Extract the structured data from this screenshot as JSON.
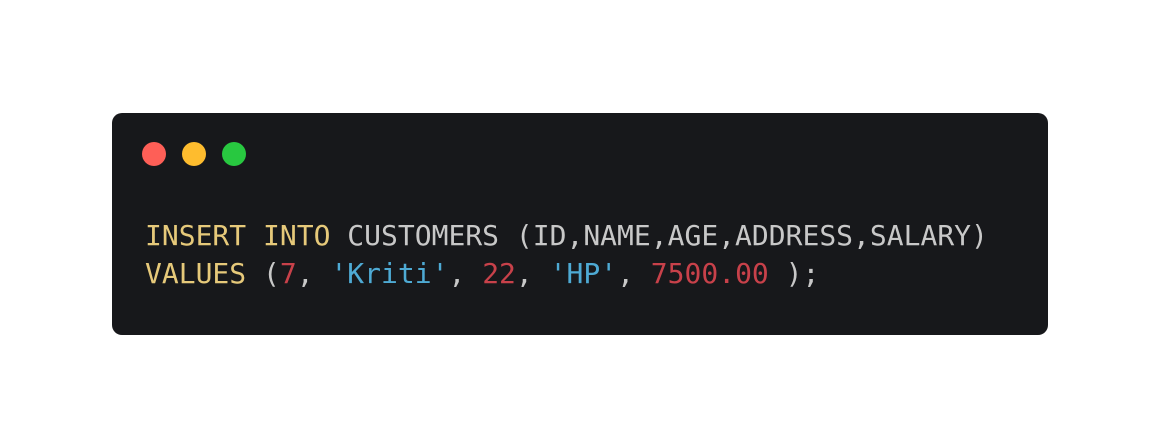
{
  "window": {
    "controls": [
      "close",
      "minimize",
      "maximize"
    ],
    "colors": {
      "background": "#17181b",
      "close": "#fe5f57",
      "minimize": "#febc2e",
      "maximize": "#28c840",
      "keyword": "#e6c97a",
      "identifier": "#c8c8c8",
      "number": "#c8414a",
      "string": "#4eaad4"
    }
  },
  "code": {
    "line1": {
      "kw_insert": "INSERT",
      "sp1": " ",
      "kw_into": "INTO",
      "rest": " CUSTOMERS (ID,NAME,AGE,ADDRESS,SALARY)"
    },
    "line2": {
      "kw_values": "VALUES",
      "open": " (",
      "id": "7",
      "c1": ", ",
      "name": "'Kriti'",
      "c2": ", ",
      "age": "22",
      "c3": ", ",
      "address": "'HP'",
      "c4": ", ",
      "salary": "7500.00",
      "close": " );"
    }
  }
}
